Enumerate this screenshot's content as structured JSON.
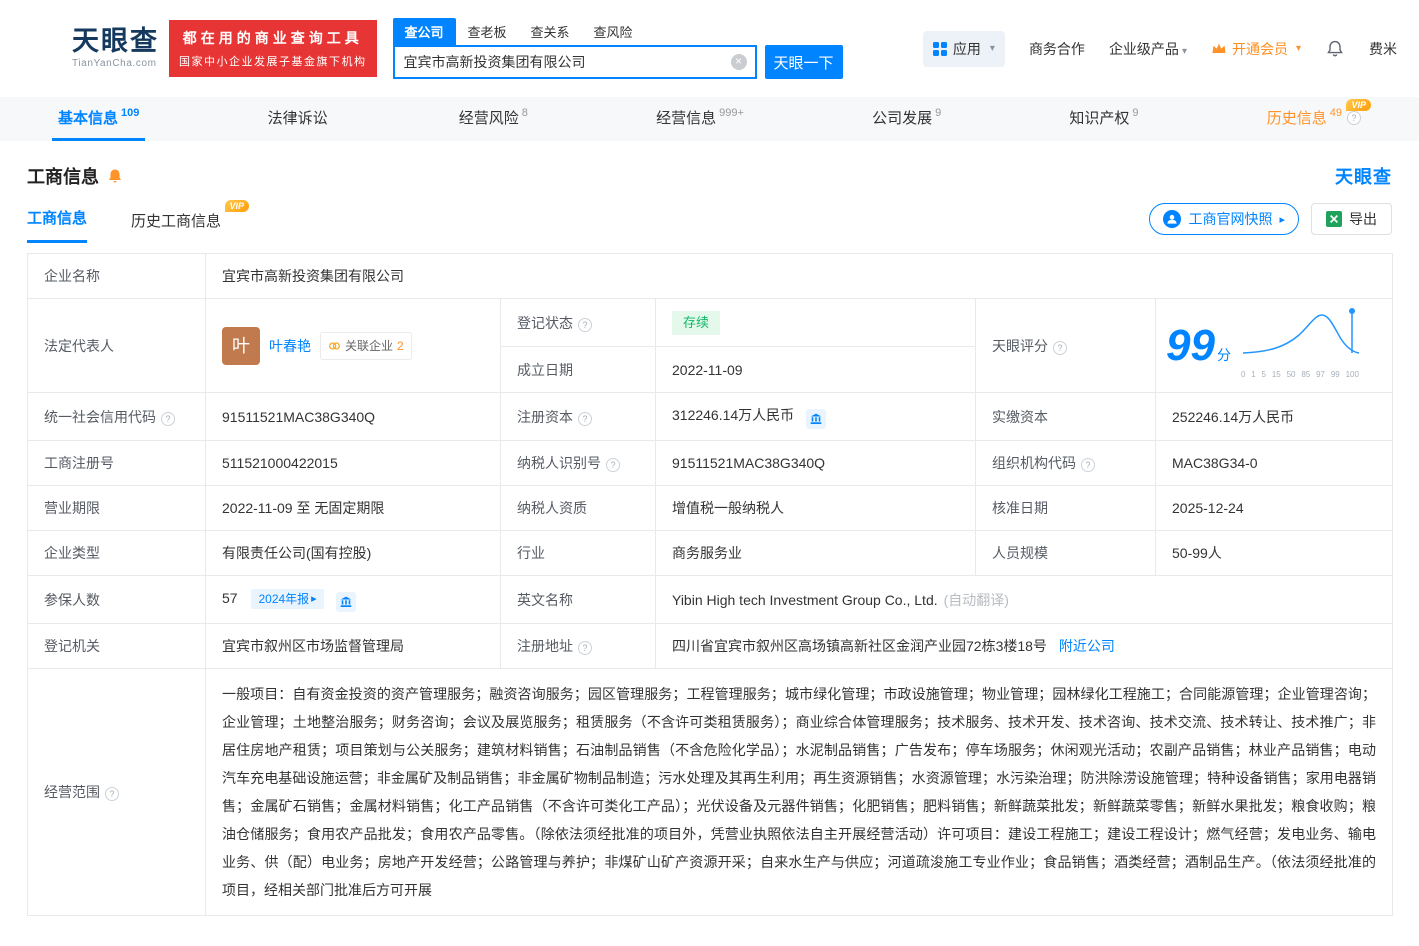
{
  "header": {
    "logo": {
      "brand": "天眼查",
      "domain": "TianYanCha.com"
    },
    "slogan": {
      "line1": "都在用的商业查询工具",
      "line2": "国家中小企业发展子基金旗下机构"
    },
    "search": {
      "tabs": [
        {
          "label": "查公司"
        },
        {
          "label": "查老板"
        },
        {
          "label": "查关系"
        },
        {
          "label": "查风险"
        }
      ],
      "value": "宜宾市高新投资集团有限公司",
      "button_label": "天眼一下"
    },
    "nav": {
      "apps_label": "应用",
      "cooperation_label": "商务合作",
      "enterprise_label": "企业级产品",
      "vip_label": "开通会员",
      "user_label": "费米"
    }
  },
  "main_tabs": [
    {
      "label": "基本信息",
      "count": "109"
    },
    {
      "label": "法律诉讼",
      "count": ""
    },
    {
      "label": "经营风险",
      "count": "8"
    },
    {
      "label": "经营信息",
      "count": "999+"
    },
    {
      "label": "公司发展",
      "count": "9"
    },
    {
      "label": "知识产权",
      "count": "9"
    },
    {
      "label": "历史信息",
      "count": "49",
      "vip": "VIP"
    }
  ],
  "section": {
    "title": "工商信息",
    "watermark_brand": "天眼查"
  },
  "subtabs": {
    "current": "工商信息",
    "history": "历史工商信息",
    "history_vip": "VIP"
  },
  "actions": {
    "snapshot_label": "工商官网快照",
    "export_label": "导出"
  },
  "info": {
    "company_name": {
      "label": "企业名称",
      "value": "宜宾市高新投资集团有限公司"
    },
    "legal_rep": {
      "label": "法定代表人",
      "avatar_char": "叶",
      "name": "叶春艳",
      "related_label": "关联企业",
      "related_count": "2"
    },
    "reg_status": {
      "label": "登记状态",
      "value": "存续"
    },
    "establish_date": {
      "label": "成立日期",
      "value": "2022-11-09"
    },
    "score": {
      "label": "天眼评分",
      "value": "99",
      "unit": "分",
      "axis": [
        "0",
        "1",
        "5",
        "15",
        "50",
        "85",
        "97",
        "99",
        "100"
      ]
    },
    "credit_code": {
      "label": "统一社会信用代码",
      "value": "91511521MAC38G340Q"
    },
    "reg_capital": {
      "label": "注册资本",
      "value": "312246.14万人民币"
    },
    "paid_capital": {
      "label": "实缴资本",
      "value": "252246.14万人民币"
    },
    "reg_number": {
      "label": "工商注册号",
      "value": "511521000422015"
    },
    "taxpayer_id": {
      "label": "纳税人识别号",
      "value": "91511521MAC38G340Q"
    },
    "org_code": {
      "label": "组织机构代码",
      "value": "MAC38G34-0"
    },
    "business_term": {
      "label": "营业期限",
      "value": "2022-11-09 至 无固定期限"
    },
    "taxpayer_quality": {
      "label": "纳税人资质",
      "value": "增值税一般纳税人"
    },
    "approval_date": {
      "label": "核准日期",
      "value": "2025-12-24"
    },
    "company_type": {
      "label": "企业类型",
      "value": "有限责任公司(国有控股)"
    },
    "industry": {
      "label": "行业",
      "value": "商务服务业"
    },
    "staff_size": {
      "label": "人员规模",
      "value": "50-99人"
    },
    "insured": {
      "label": "参保人数",
      "value": "57",
      "badge": "2024年报"
    },
    "english_name": {
      "label": "英文名称",
      "value": "Yibin High tech Investment Group Co., Ltd.",
      "note": "(自动翻译)"
    },
    "reg_authority": {
      "label": "登记机关",
      "value": "宜宾市叙州区市场监督管理局"
    },
    "reg_address": {
      "label": "注册地址",
      "value": "四川省宜宾市叙州区高场镇高新社区金润产业园72栋3楼18号",
      "link": "附近公司"
    },
    "business_scope": {
      "label": "经营范围",
      "value": "一般项目：自有资金投资的资产管理服务；融资咨询服务；园区管理服务；工程管理服务；城市绿化管理；市政设施管理；物业管理；园林绿化工程施工；合同能源管理；企业管理咨询；企业管理；土地整治服务；财务咨询；会议及展览服务；租赁服务（不含许可类租赁服务）；商业综合体管理服务；技术服务、技术开发、技术咨询、技术交流、技术转让、技术推广；非居住房地产租赁；项目策划与公关服务；建筑材料销售；石油制品销售（不含危险化学品）；水泥制品销售；广告发布；停车场服务；休闲观光活动；农副产品销售；林业产品销售；电动汽车充电基础设施运营；非金属矿及制品销售；非金属矿物制品制造；污水处理及其再生利用；再生资源销售；水资源管理；水污染治理；防洪除涝设施管理；特种设备销售；家用电器销售；金属矿石销售；金属材料销售；化工产品销售（不含许可类化工产品）；光伏设备及元器件销售；化肥销售；肥料销售；新鲜蔬菜批发；新鲜蔬菜零售；新鲜水果批发；粮食收购；粮油仓储服务；食用农产品批发；食用农产品零售。（除依法须经批准的项目外，凭营业执照依法自主开展经营活动）许可项目：建设工程施工；建设工程设计；燃气经营；发电业务、输电业务、供（配）电业务；房地产开发经营；公路管理与养护；非煤矿山矿产资源开采；自来水生产与供应；河道疏浚施工专业作业；食品销售；酒类经营；酒制品生产。（依法须经批准的项目，经相关部门批准后方可开展"
    }
  },
  "colors": {
    "primary": "#0084ff",
    "brand_red": "#e73535",
    "vip_orange": "#ff9329",
    "status_green": "#0fb964"
  }
}
